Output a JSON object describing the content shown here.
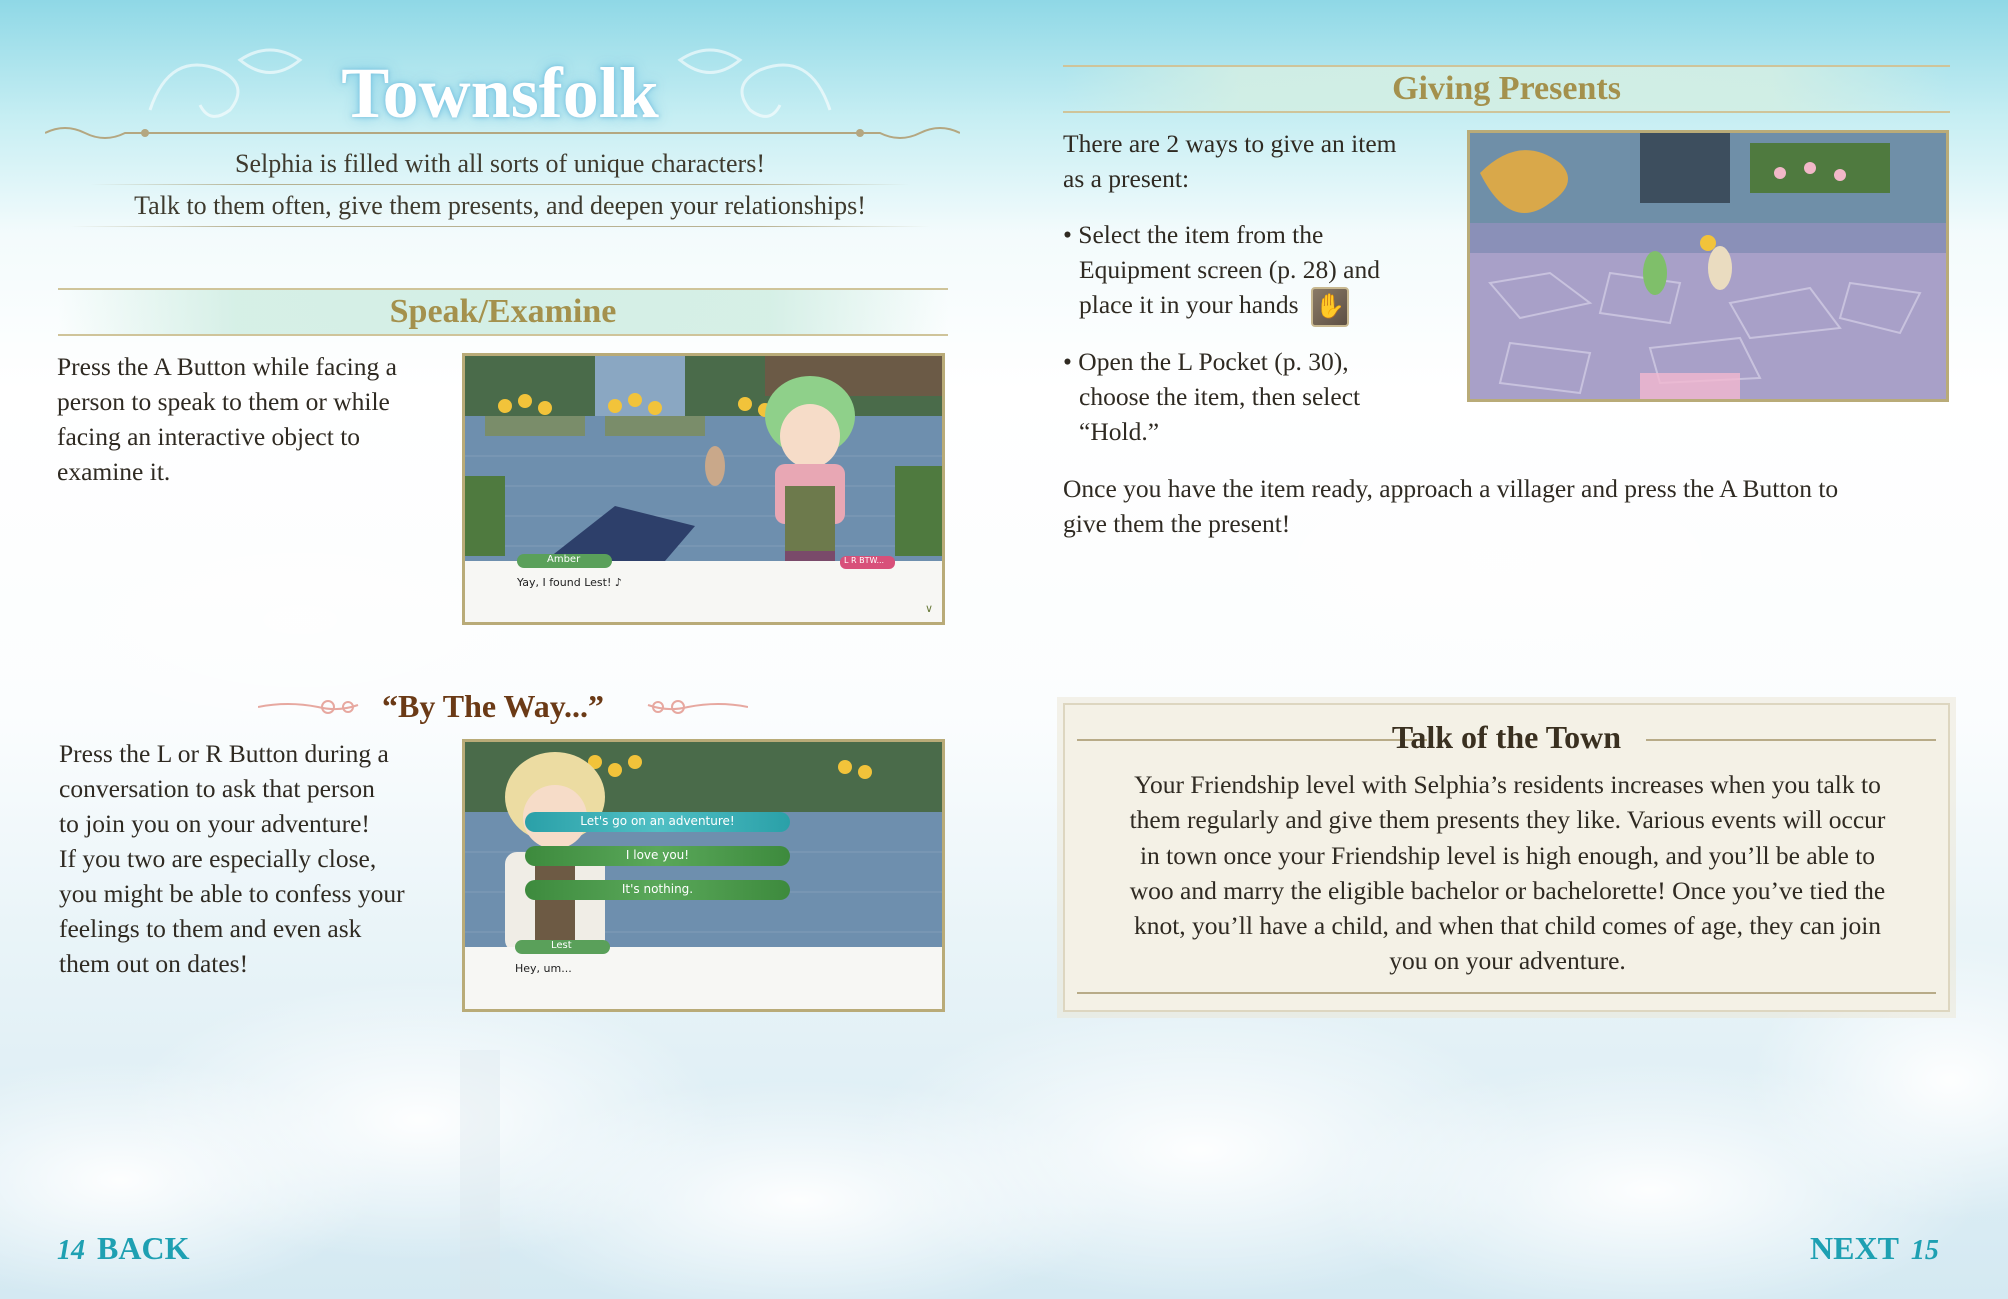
{
  "page": {
    "title": "Townsfolk",
    "intro_line1": "Selphia is filled with all sorts of unique characters!",
    "intro_line2": "Talk to them often, give them presents, and deepen your relationships!"
  },
  "speak": {
    "heading": "Speak/Examine",
    "body": [
      "Press the A Button while facing a",
      "person to speak to them or while",
      "facing an interactive object to",
      "examine it."
    ],
    "screenshot": {
      "speaker": "Amber",
      "dialogue": "Yay, I found Lest! ♪",
      "badge": "L R BTW...",
      "advance_glyph": "∨"
    }
  },
  "btw": {
    "heading": "“By The Way...”",
    "body": [
      "Press the L or R Button during a",
      "conversation to ask that person",
      "to join you on your adventure!",
      "If you two are especially close,",
      "you might be able to confess your",
      "feelings to them and even ask",
      "them out on dates!"
    ],
    "screenshot": {
      "choices": [
        "Let's go on an adventure!",
        "I love you!",
        "It's nothing."
      ],
      "speaker": "Lest",
      "dialogue": "Hey, um..."
    }
  },
  "presents": {
    "heading": "Giving Presents",
    "intro": [
      "There are 2 ways to give an item",
      "as a present:"
    ],
    "bullet1": [
      "• Select the item from the",
      "Equipment screen (p. 28) and",
      "place it in your hands"
    ],
    "bullet2": [
      "• Open the L Pocket (p. 30),",
      "choose the item, then select",
      "“Hold.”"
    ],
    "closing": [
      "Once you have the item ready, approach a villager and press the A Button to",
      "give them the present!"
    ]
  },
  "talk_of_town": {
    "heading": "Talk of the Town",
    "body": [
      "Your Friendship level with Selphia’s residents increases when you talk to",
      "them regularly and give them presents they like. Various events will occur",
      "in town once your Friendship level is high enough, and you’ll be able to",
      "woo and marry the eligible bachelor or bachelorette! Once you’ve tied the",
      "knot, you’ll have a child, and when that child comes of age, they can join",
      "you on your adventure."
    ]
  },
  "nav": {
    "left_page": "14",
    "back_label": "BACK",
    "next_label": "NEXT",
    "right_page": "15"
  },
  "colors": {
    "accent_teal": "#1ea0b2",
    "heading_gold": "#a4914d",
    "btw_brown": "#6b3a16"
  }
}
